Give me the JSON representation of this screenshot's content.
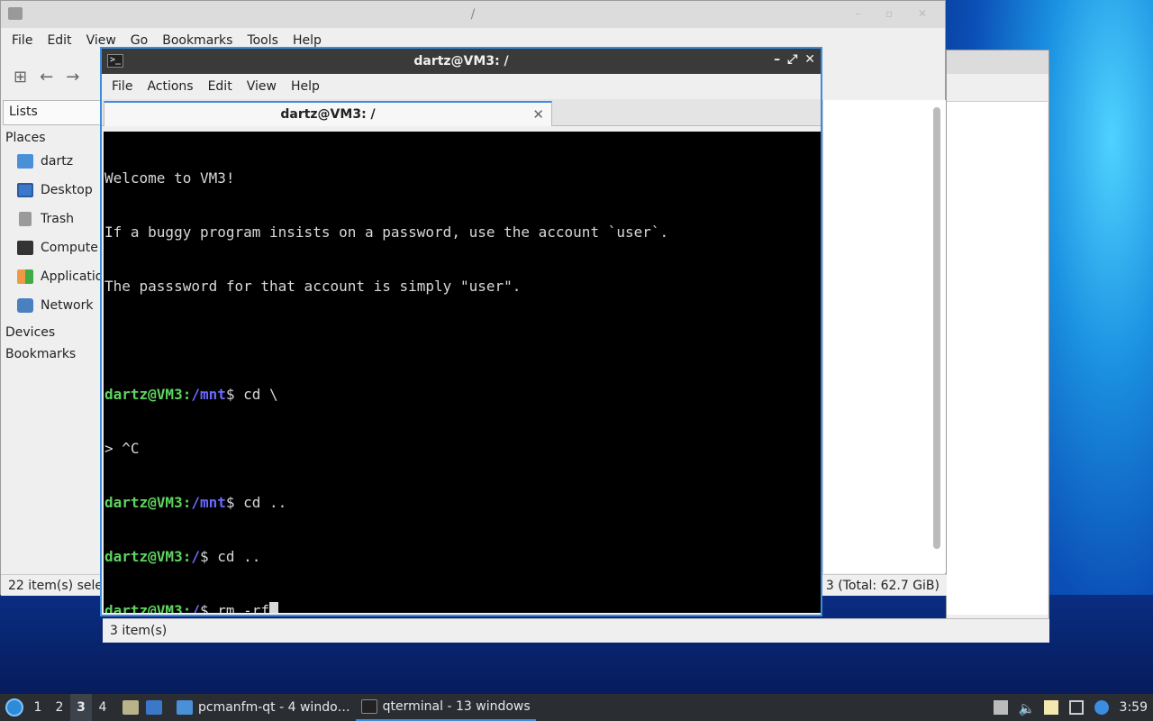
{
  "fm": {
    "title": "/",
    "menu": [
      "File",
      "Edit",
      "View",
      "Go",
      "Bookmarks",
      "Tools",
      "Help"
    ],
    "side_tab": "Lists",
    "places_header": "Places",
    "places": [
      "dartz",
      "Desktop",
      "Trash",
      "Compute",
      "Applicatio",
      "Network"
    ],
    "devices_header": "Devices",
    "bookmarks_header": "Bookmarks",
    "status_left": "22 item(s) selec",
    "status_right": "3 (Total: 62.7 GiB)"
  },
  "fm2": {
    "status": "3 item(s)"
  },
  "terminal": {
    "title": "dartz@VM3: /",
    "menu": [
      "File",
      "Actions",
      "Edit",
      "View",
      "Help"
    ],
    "tab_label": "dartz@VM3: /",
    "welcome": [
      "Welcome to VM3!",
      "If a buggy program insists on a password, use the account `user`.",
      "The passsword for that account is simply \"user\"."
    ],
    "prompt_user": "dartz@VM3",
    "lines": [
      {
        "path": "/mnt",
        "cmd": "$ cd \\"
      },
      {
        "cont": "> ^C"
      },
      {
        "path": "/mnt",
        "cmd": "$ cd .."
      },
      {
        "path": "/",
        "cmd": "$ cd .."
      },
      {
        "path": "/",
        "cmd": "$ rm -rf"
      }
    ]
  },
  "taskbar": {
    "workspaces": [
      "1",
      "2",
      "3",
      "4"
    ],
    "active_workspace": "3",
    "tasks": [
      "pcmanfm-qt - 4 windo…",
      "qterminal - 13 windows"
    ],
    "clock": "3:59"
  }
}
